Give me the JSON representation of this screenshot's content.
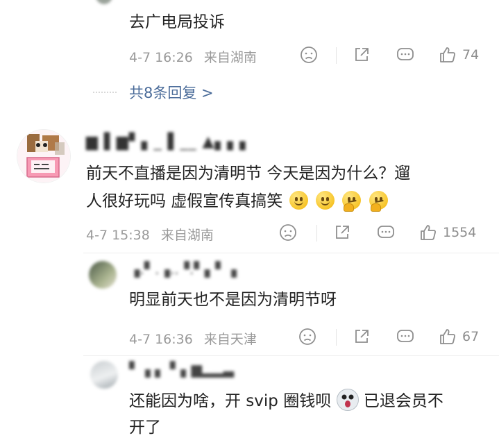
{
  "thread_top": {
    "comment_text": "去广电局投诉",
    "time": "4-7 16:26",
    "location": "来自湖南",
    "like_count": "74",
    "replies_link": "共8条回复 >"
  },
  "main_comment": {
    "username": "▆ ▌▆▘▖_ ▌__ ▲▖▖▖",
    "text_line1": "前天不直播是因为清明节 今天是因为什么？遛",
    "text_line2": "人很好玩吗 虚假宣传真搞笑",
    "time": "4-7 15:38",
    "location": "来自湖南",
    "like_count": "1554"
  },
  "reply_1": {
    "username": "▗.▘.▗..▝.▘▖▘▗",
    "text": "明显前天也不是因为清明节呀",
    "time": "4-7 16:36",
    "location": "来自天津",
    "like_count": "67"
  },
  "reply_2": {
    "username": "▘▗ ▖ ▘▖▆▂▂▃",
    "text_line1_a": "还能因为啥，开 svip 圈钱呗",
    "text_line1_b": "已退会员不",
    "text_line2": "开了"
  },
  "colors": {
    "meta_gray": "#9a9a9a",
    "link_blue": "#4a6b99",
    "text": "#222222"
  },
  "icons": [
    "dislike-icon",
    "share-icon",
    "comment-icon",
    "like-icon",
    "smile-emoji",
    "think-emoji",
    "scream-emoji"
  ]
}
